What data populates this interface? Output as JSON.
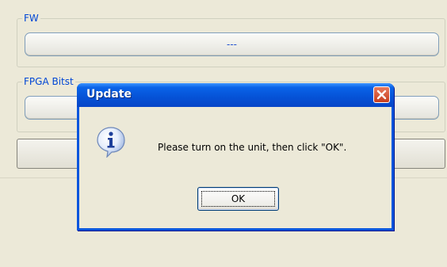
{
  "background_window": {
    "fw_group": {
      "label": "FW",
      "value": "---"
    },
    "fpga_group": {
      "label": "FPGA Bitst",
      "value": ""
    }
  },
  "dialog": {
    "title": "Update",
    "message": "Please turn on the unit, then click \"OK\".",
    "ok_label": "OK",
    "icon": "info-icon",
    "close_icon": "close-icon"
  },
  "colors": {
    "title_bar": "#0855dd",
    "close_button": "#d1462a",
    "group_label": "#0046d5",
    "window_bg": "#ece9d8"
  }
}
